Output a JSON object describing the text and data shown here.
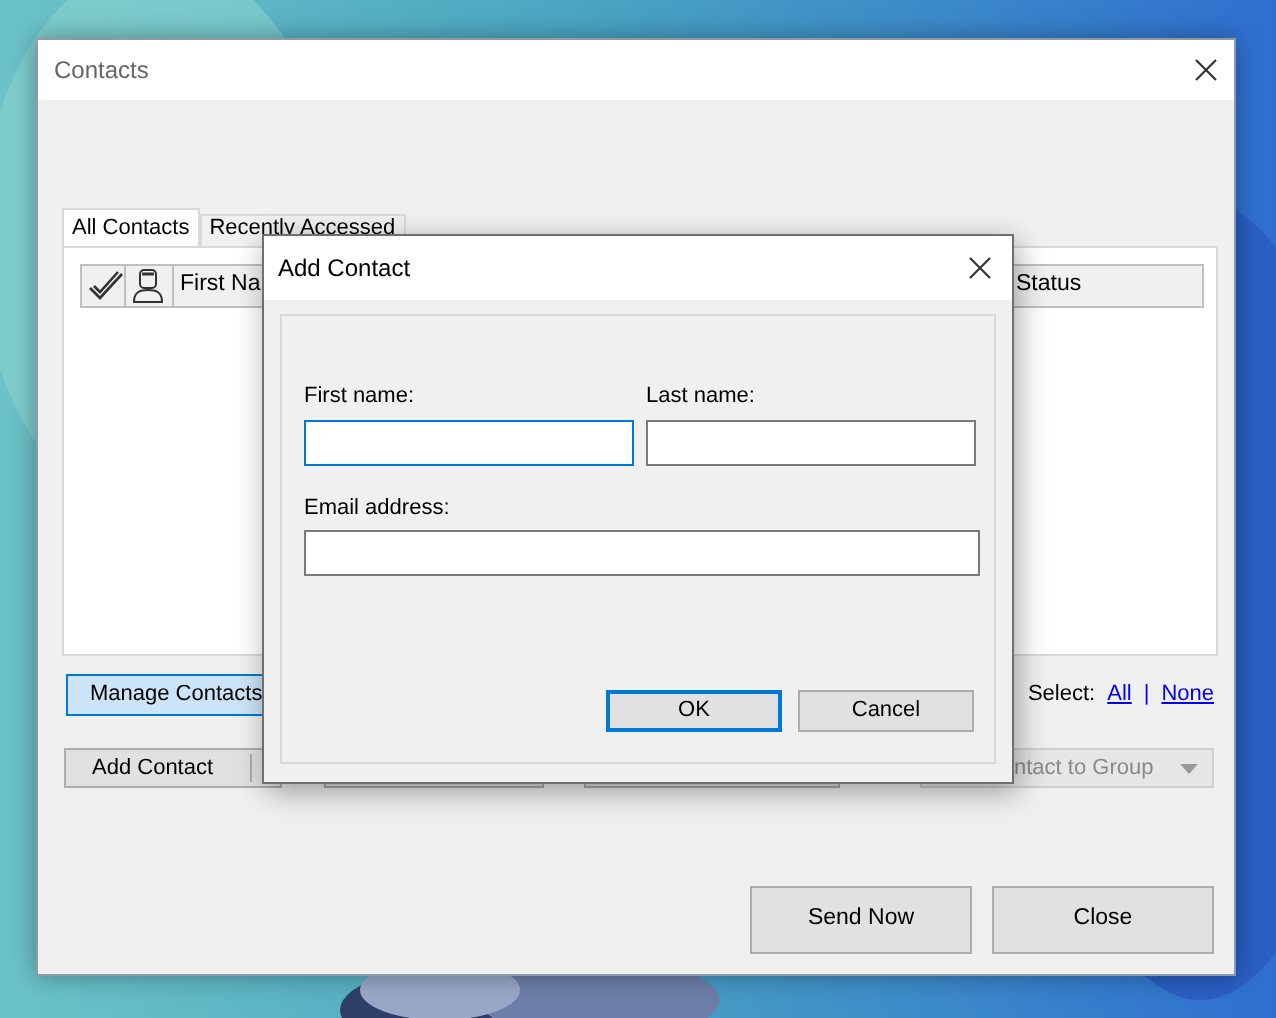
{
  "window": {
    "title": "Contacts"
  },
  "tabs": [
    {
      "label": "All Contacts",
      "selected": true
    },
    {
      "label": "Recently Accessed",
      "selected": false
    }
  ],
  "table": {
    "columns": [
      {
        "kind": "check-icon"
      },
      {
        "kind": "person-icon"
      },
      {
        "kind": "text",
        "label": "First Na"
      },
      {
        "kind": "text",
        "label": "Status"
      }
    ]
  },
  "manage_button": {
    "label": "Manage Contacts",
    "selected": true
  },
  "select": {
    "label": "Select:",
    "links": [
      "All",
      "None"
    ],
    "separator": "|"
  },
  "action_row": [
    {
      "kind": "split",
      "label": "Add Contact",
      "disabled": false
    },
    {
      "kind": "button"
    },
    {
      "kind": "button"
    },
    {
      "kind": "dropdown",
      "label": "ntact to Group",
      "disabled": true
    }
  ],
  "footer_buttons": [
    "Send Now",
    "Close"
  ],
  "dialog": {
    "title": "Add Contact",
    "rows": [
      [
        {
          "label": "First name:",
          "focused": true
        },
        {
          "label": "Last name:",
          "focused": false
        }
      ],
      [
        {
          "label": "Email address:",
          "focused": false
        }
      ]
    ],
    "buttons": [
      {
        "label": "OK",
        "default": true
      },
      {
        "label": "Cancel",
        "default": false
      }
    ]
  }
}
